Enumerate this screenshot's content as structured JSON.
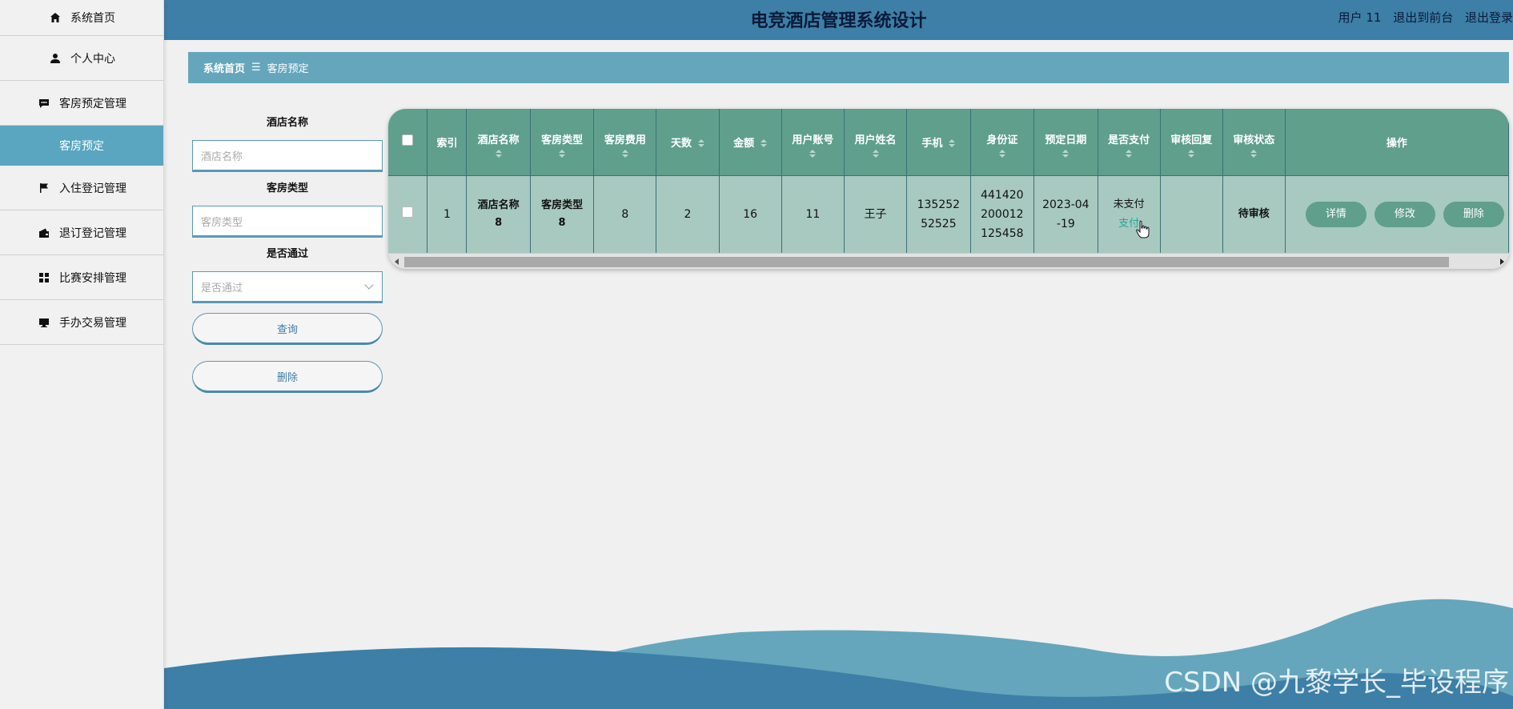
{
  "sidebar": {
    "items": [
      {
        "label": "系统首页",
        "icon": "home-icon"
      },
      {
        "label": "个人中心",
        "icon": "user-icon"
      },
      {
        "label": "客房预定管理",
        "icon": "chat-icon"
      },
      {
        "label": "客房预定",
        "icon": ""
      },
      {
        "label": "入住登记管理",
        "icon": "flag-icon"
      },
      {
        "label": "退订登记管理",
        "icon": "wallet-icon"
      },
      {
        "label": "比赛安排管理",
        "icon": "grid-icon"
      },
      {
        "label": "手办交易管理",
        "icon": "monitor-icon"
      }
    ]
  },
  "header": {
    "title": "电竞酒店管理系统设计",
    "user": "用户 11",
    "front": "退出到前台",
    "logout": "退出登录"
  },
  "breadcrumb": {
    "home": "系统首页",
    "separator": "☰",
    "current": "客房预定"
  },
  "search": {
    "hotel_label": "酒店名称",
    "hotel_placeholder": "酒店名称",
    "room_label": "客房类型",
    "room_placeholder": "客房类型",
    "pass_label": "是否通过",
    "pass_placeholder": "是否通过",
    "query_button": "查询",
    "delete_button": "删除"
  },
  "table": {
    "headers": [
      "索引",
      "酒店名称",
      "客房类型",
      "客房费用",
      "天数",
      "金额",
      "用户账号",
      "用户姓名",
      "手机",
      "身份证",
      "预定日期",
      "是否支付",
      "审核回复",
      "审核状态",
      "操作"
    ],
    "row": {
      "index": "1",
      "hotel_name": "酒店名称8",
      "room_type": "客房类型8",
      "room_fee": "8",
      "days": "2",
      "amount": "16",
      "account": "11",
      "username": "王子",
      "phone": "13525252525",
      "id_card": "441420200012125458",
      "date": "2023-04-19",
      "paid": "未支付",
      "pay_link": "支付",
      "reply": "",
      "status": "待审核",
      "detail_btn": "详情",
      "edit_btn": "修改",
      "delete_btn": "删除"
    }
  },
  "watermark": "CSDN @九黎学长_毕设程序",
  "colors": {
    "header": "#3d7fa6",
    "accent": "#65a6bd",
    "table_header": "#5f9f8c",
    "table_row": "#a8c9bf"
  }
}
